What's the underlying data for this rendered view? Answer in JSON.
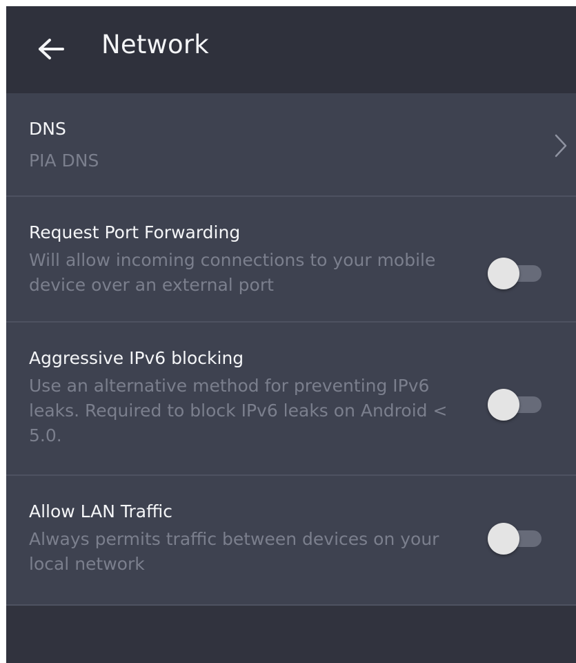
{
  "header": {
    "title": "Network",
    "back_icon": "arrow-left-icon"
  },
  "colors": {
    "app_bar": "#2f313c",
    "list_background": "#3e4250",
    "page_background": "#31333e",
    "primary_text": "#f4f5f7",
    "secondary_text": "#7b7f8d",
    "toggle_knob": "#e4e4e4",
    "toggle_track": "#676b79"
  },
  "settings": {
    "dns": {
      "title": "DNS",
      "value": "PIA DNS",
      "icon": "chevron-right-icon"
    },
    "port_forwarding": {
      "title": "Request Port Forwarding",
      "description": "Will allow incoming connections to your mobile device over an external port",
      "enabled": false
    },
    "ipv6_blocking": {
      "title": "Aggressive IPv6 blocking",
      "description": "Use an alternative method for preventing IPv6 leaks. Required to block IPv6 leaks on Android < 5.0.",
      "enabled": false
    },
    "lan_traffic": {
      "title": "Allow LAN Traffic",
      "description": "Always permits traffic between devices on your local network",
      "enabled": false
    }
  }
}
